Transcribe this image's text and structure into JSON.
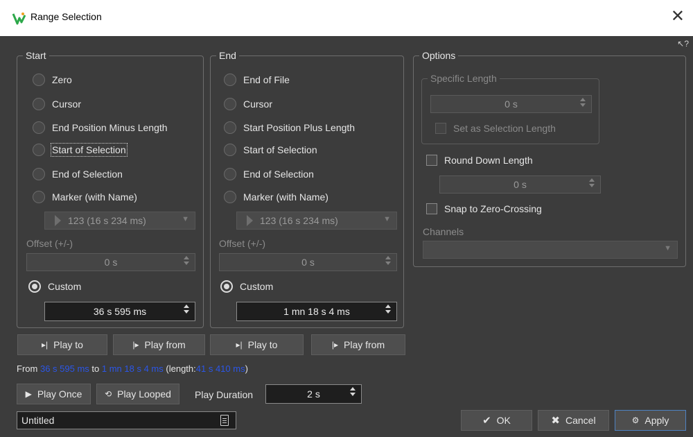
{
  "window": {
    "title": "Range Selection",
    "close_glyph": "✕",
    "help_glyph": "↖?"
  },
  "start": {
    "label": "Start",
    "options": [
      "Zero",
      "Cursor",
      "End Position Minus Length",
      "Start of Selection",
      "End of Selection",
      "Marker (with Name)"
    ],
    "focused_option_index": 3,
    "marker_combo": "123 (16 s 234 ms)",
    "offset_label": "Offset (+/-)",
    "offset_value": "0 s",
    "custom_label": "Custom",
    "custom_value": "36 s 595 ms",
    "selected": "Custom"
  },
  "end": {
    "label": "End",
    "options": [
      "End of File",
      "Cursor",
      "Start Position Plus Length",
      "Start of Selection",
      "End of Selection",
      "Marker (with Name)"
    ],
    "marker_combo": "123 (16 s 234 ms)",
    "offset_label": "Offset (+/-)",
    "offset_value": "0 s",
    "custom_label": "Custom",
    "custom_value": "1 mn 18 s 4 ms",
    "selected": "Custom"
  },
  "options": {
    "label": "Options",
    "specific_length_label": "Specific Length",
    "specific_length_value": "0 s",
    "set_as_selection_length": "Set as Selection Length",
    "round_down_length": "Round Down Length",
    "round_down_value": "0 s",
    "snap_to_zero": "Snap to Zero-Crossing",
    "channels_label": "Channels",
    "channels_value": ""
  },
  "play_buttons": {
    "play_to": "Play to",
    "play_from": "Play from"
  },
  "info": {
    "from": "From",
    "from_value": "36 s 595 ms",
    "to": "to",
    "to_value": "1 mn 18 s 4 ms",
    "length_open": "(length:",
    "length_value": "41 s 410 ms",
    "length_close": ")"
  },
  "playback": {
    "play_once": "Play Once",
    "play_looped": "Play Looped",
    "duration_label": "Play Duration",
    "duration_value": "2 s"
  },
  "preset_name": "Untitled",
  "footer": {
    "ok": "OK",
    "cancel": "Cancel",
    "apply": "Apply"
  },
  "colors": {
    "accent_blue": "#2b56e8",
    "primary_border": "#4f82c2",
    "bg": "#3c3c3c"
  }
}
